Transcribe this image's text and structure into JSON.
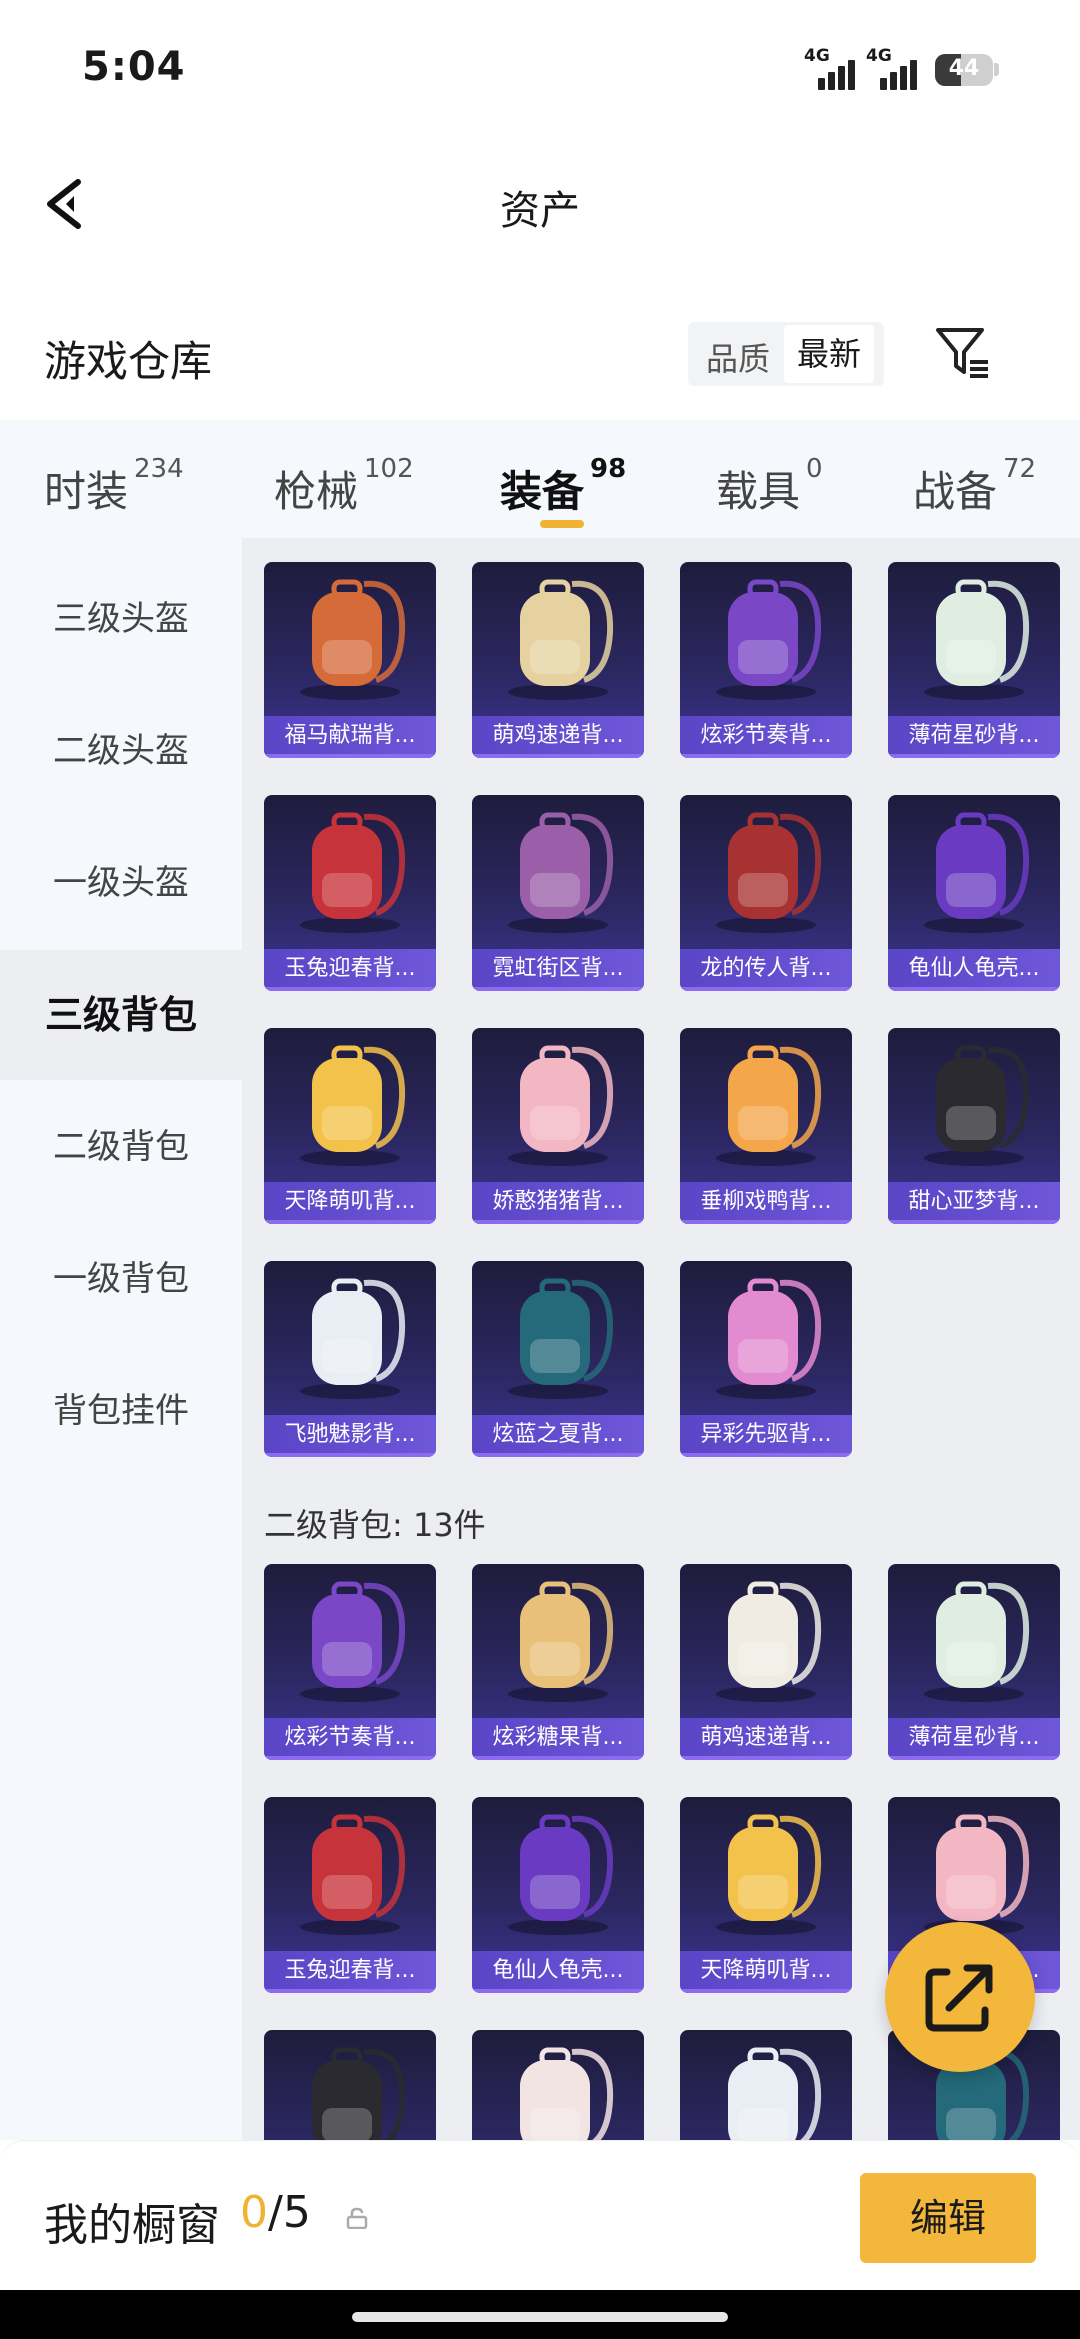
{
  "status_bar": {
    "time": "5:04",
    "signal1_label": "4G",
    "signal2_label": "4G",
    "battery": "44",
    "battery_level": 0.44
  },
  "header": {
    "title": "资产"
  },
  "warehouse": {
    "title": "游戏仓库",
    "sort_quality": "品质",
    "sort_latest": "最新"
  },
  "tabs": [
    {
      "label": "时装",
      "count": "234"
    },
    {
      "label": "枪械",
      "count": "102"
    },
    {
      "label": "装备",
      "count": "98",
      "active": true
    },
    {
      "label": "载具",
      "count": "0"
    },
    {
      "label": "战备",
      "count": "72"
    }
  ],
  "sidebar": [
    {
      "label": "三级头盔"
    },
    {
      "label": "二级头盔"
    },
    {
      "label": "一级头盔"
    },
    {
      "label": "三级背包",
      "active": true
    },
    {
      "label": "二级背包"
    },
    {
      "label": "一级背包"
    },
    {
      "label": "背包挂件"
    }
  ],
  "level3_items": [
    {
      "name": "福马献瑞背...",
      "icon": "backpack-horse",
      "color": "#d66b3a"
    },
    {
      "name": "萌鸡速递背...",
      "icon": "backpack-chick",
      "color": "#e5d2a0"
    },
    {
      "name": "炫彩节奏背...",
      "icon": "backpack-purple",
      "color": "#7a47c7"
    },
    {
      "name": "薄荷星砂背...",
      "icon": "backpack-mint",
      "color": "#dfeee0"
    },
    {
      "name": "玉兔迎春背...",
      "icon": "backpack-red-white",
      "color": "#c7333a"
    },
    {
      "name": "霓虹街区背...",
      "icon": "backpack-neon",
      "color": "#9a5fa8"
    },
    {
      "name": "龙的传人背...",
      "icon": "backpack-dragon",
      "color": "#a83232"
    },
    {
      "name": "龟仙人龟壳...",
      "icon": "backpack-turtle",
      "color": "#6a3bc2"
    },
    {
      "name": "天降萌叽背...",
      "icon": "backpack-yellow",
      "color": "#f3c24b"
    },
    {
      "name": "娇憨猪猪背...",
      "icon": "backpack-pig",
      "color": "#f2b7c2"
    },
    {
      "name": "垂柳戏鸭背...",
      "icon": "backpack-duck",
      "color": "#f4a64a"
    },
    {
      "name": "甜心亚梦背...",
      "icon": "backpack-black",
      "color": "#2a2a30"
    },
    {
      "name": "飞驰魅影背...",
      "icon": "backpack-white-yellow",
      "color": "#e9eef4"
    },
    {
      "name": "炫蓝之夏背...",
      "icon": "backpack-teal",
      "color": "#246a7a"
    },
    {
      "name": "异彩先驱背...",
      "icon": "backpack-pink",
      "color": "#e38bd0"
    }
  ],
  "level2_section": "二级背包: 13件",
  "level2_items": [
    {
      "name": "炫彩节奏背...",
      "icon": "backpack-purple",
      "color": "#7a47c7"
    },
    {
      "name": "炫彩糖果背...",
      "icon": "backpack-candy",
      "color": "#e8c07a"
    },
    {
      "name": "萌鸡速递背...",
      "icon": "backpack-chick",
      "color": "#f0ece4"
    },
    {
      "name": "薄荷星砂背...",
      "icon": "backpack-mint",
      "color": "#dfeee0"
    },
    {
      "name": "玉兔迎春背...",
      "icon": "backpack-red-white",
      "color": "#c7333a"
    },
    {
      "name": "龟仙人龟壳...",
      "icon": "backpack-turtle",
      "color": "#6a3bc2"
    },
    {
      "name": "天降萌叽背...",
      "icon": "backpack-yellow",
      "color": "#f3c24b"
    },
    {
      "name": "娇憨猪猪背...",
      "icon": "backpack-pig",
      "color": "#f2b7c2"
    },
    {
      "name": "",
      "icon": "backpack-black",
      "color": "#2a2a30"
    },
    {
      "name": "",
      "icon": "backpack-white-pink",
      "color": "#f3e4e4"
    },
    {
      "name": "",
      "icon": "backpack-white-yellow",
      "color": "#e9eef4"
    },
    {
      "name": "",
      "icon": "backpack-teal",
      "color": "#246a7a"
    }
  ],
  "footer": {
    "my_window": "我的橱窗",
    "current": "0",
    "separator": "/",
    "max": "5",
    "edit": "编辑"
  },
  "colors": {
    "accent": "#f3b73b",
    "card_label": "#5a45c6"
  }
}
